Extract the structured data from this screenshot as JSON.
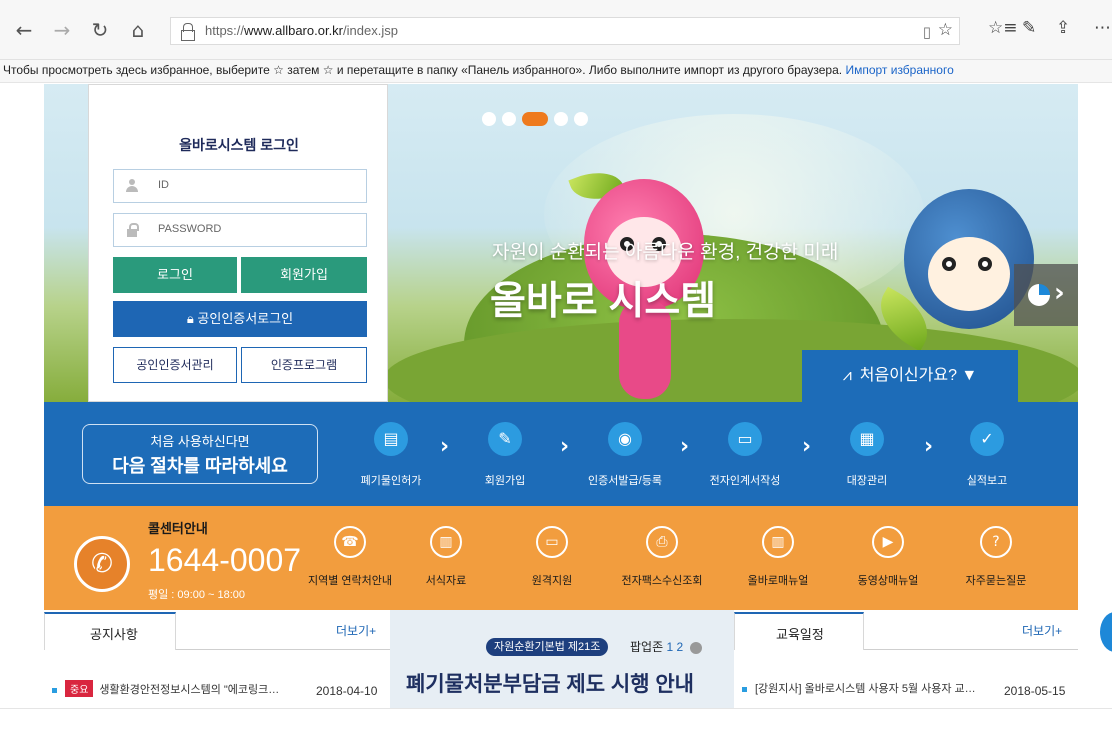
{
  "browser": {
    "url_prefix": "https://",
    "url_domain": "www.allbaro.or.kr",
    "url_path": "/index.jsp",
    "icons": [
      "back-icon",
      "forward-icon",
      "refresh-icon",
      "home-icon",
      "lock-icon",
      "reader-icon",
      "star-icon",
      "favorites-icon",
      "pen-icon",
      "share-icon",
      "more-icon"
    ]
  },
  "favbar": {
    "text": "Чтобы просмотреть здесь избранное, выберите ☆ затем ☆ и перетащите в папку «Панель избранного». Либо выполните импорт из другого браузера.",
    "link": "Импорт избранного"
  },
  "login": {
    "title": "올바로시스템 로그인",
    "id_placeholder": "ID",
    "pw_placeholder": "PASSWORD",
    "login_btn": "로그인",
    "join_btn": "회원가입",
    "cert_login_btn": "공인인증서로그인",
    "cert_manage_btn": "공인인증서관리",
    "cert_program_btn": "인증프로그램"
  },
  "hero": {
    "subtitle": "자원이 순환되는 아름다운 환경, 건강한 미래",
    "title": "올바로 시스템",
    "slide_count": 5,
    "active_slide": 3,
    "first_time_btn": "처음이신가요?"
  },
  "process": {
    "line1": "처음 사용하신다면",
    "line2": "다음 절차를 따라하세요",
    "steps": [
      {
        "label": "폐기물인허가",
        "icon": "document-icon"
      },
      {
        "label": "회원가입",
        "icon": "edit-icon"
      },
      {
        "label": "인증서발급/등록",
        "icon": "certificate-icon"
      },
      {
        "label": "전자인계서작성",
        "icon": "monitor-icon"
      },
      {
        "label": "대장관리",
        "icon": "ledger-icon"
      },
      {
        "label": "실적보고",
        "icon": "clipboard-check-icon"
      }
    ]
  },
  "callcenter": {
    "title": "콜센터안내",
    "phone": "1644-0007",
    "hours": "평일 : 09:00 ~ 18:00",
    "links": [
      {
        "label": "지역별 연락처안내",
        "icon": "phonebook-icon"
      },
      {
        "label": "서식자료",
        "icon": "book-icon"
      },
      {
        "label": "원격지원",
        "icon": "remote-icon"
      },
      {
        "label": "전자팩스수신조회",
        "icon": "fax-icon"
      },
      {
        "label": "올바로매뉴얼",
        "icon": "manual-icon"
      },
      {
        "label": "동영상매뉴얼",
        "icon": "video-icon"
      },
      {
        "label": "자주묻는질문",
        "icon": "faq-icon"
      }
    ]
  },
  "notices": {
    "title": "공지사항",
    "more": "더보기+",
    "badge": "중요",
    "item": "생활환경안전정보시스템의 \"에코링크…",
    "date": "2018-04-10"
  },
  "popup": {
    "law_badge": "자원순환기본법 제21조",
    "zone_label": "팝업존",
    "page1": "1",
    "page2": "2",
    "title": "폐기물처분부담금 제도 시행 안내"
  },
  "education": {
    "title": "교육일정",
    "more": "더보기+",
    "item": "[강원지사] 올바로시스템 사용자 5월 사용자 교…",
    "date": "2018-05-15"
  },
  "colors": {
    "primary_blue": "#1d6cb8",
    "green": "#2a9a7c",
    "orange": "#f29d3e",
    "active_dot": "#ee7a1d"
  }
}
